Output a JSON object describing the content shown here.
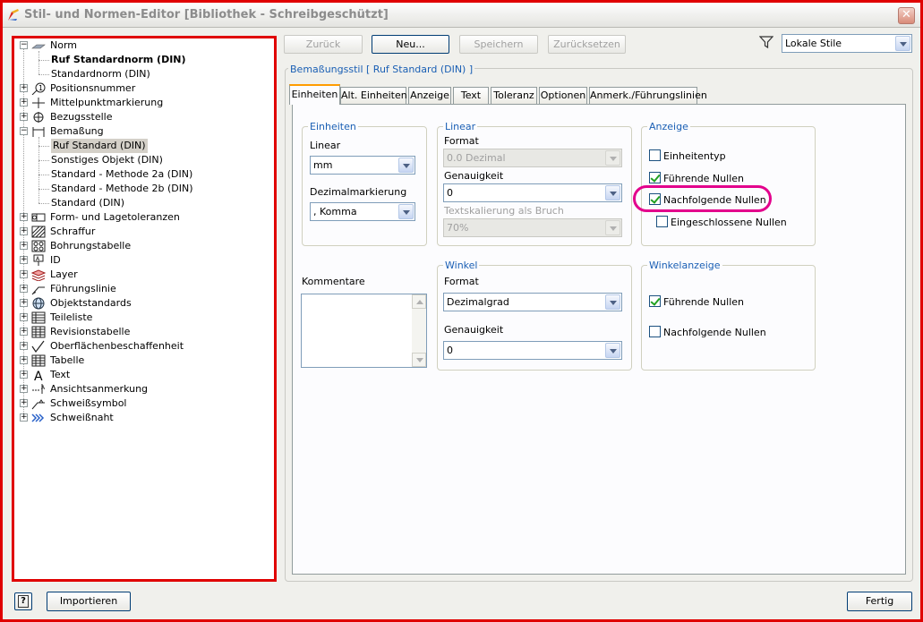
{
  "window": {
    "title": "Stil- und Normen-Editor [Bibliothek - Schreibgeschützt]",
    "close_glyph": "✕"
  },
  "toolbar": {
    "back": "Zurück",
    "new": "Neu...",
    "save": "Speichern",
    "reset": "Zurücksetzen",
    "filter_value": "Lokale Stile"
  },
  "tree": {
    "items": [
      {
        "label": "Norm",
        "icon": "norm-icon",
        "expander": "−"
      },
      {
        "label": "Ruf Standardnorm (DIN)",
        "bold": true
      },
      {
        "label": "Standardnorm (DIN)"
      },
      {
        "label": "Positionsnummer",
        "icon": "balloon-icon",
        "expander": "+"
      },
      {
        "label": "Mittelpunktmarkierung",
        "icon": "center-mark-icon",
        "expander": "+"
      },
      {
        "label": "Bezugsstelle",
        "icon": "datum-icon",
        "expander": "+"
      },
      {
        "label": "Bemaßung",
        "icon": "dimension-icon",
        "expander": "−"
      },
      {
        "label": "Ruf Standard (DIN)",
        "selected": true
      },
      {
        "label": "Sonstiges Objekt (DIN)"
      },
      {
        "label": "Standard - Methode 2a (DIN)"
      },
      {
        "label": "Standard - Methode 2b (DIN)"
      },
      {
        "label": "Standard (DIN)"
      },
      {
        "label": "Form- und Lagetoleranzen",
        "icon": "gdt-icon",
        "expander": "+"
      },
      {
        "label": "Schraffur",
        "icon": "hatch-icon",
        "expander": "+"
      },
      {
        "label": "Bohrungstabelle",
        "icon": "hole-table-icon",
        "expander": "+"
      },
      {
        "label": "ID",
        "icon": "id-icon",
        "expander": "+"
      },
      {
        "label": "Layer",
        "icon": "layer-icon",
        "expander": "+"
      },
      {
        "label": "Führungslinie",
        "icon": "leader-icon",
        "expander": "+"
      },
      {
        "label": "Objektstandards",
        "icon": "globe-icon",
        "expander": "+"
      },
      {
        "label": "Teileliste",
        "icon": "parts-list-icon",
        "expander": "+"
      },
      {
        "label": "Revisionstabelle",
        "icon": "revision-table-icon",
        "expander": "+"
      },
      {
        "label": "Oberflächenbeschaffenheit",
        "icon": "surface-icon",
        "expander": "+"
      },
      {
        "label": "Tabelle",
        "icon": "table-icon",
        "expander": "+"
      },
      {
        "label": "Text",
        "icon": "text-icon",
        "expander": "+"
      },
      {
        "label": "Ansichtsanmerkung",
        "icon": "view-annotation-icon",
        "expander": "+"
      },
      {
        "label": "Schweißsymbol",
        "icon": "weld-symbol-icon",
        "expander": "+"
      },
      {
        "label": "Schweißnaht",
        "icon": "weld-bead-icon",
        "expander": "+"
      }
    ]
  },
  "style_header": "Bemaßungsstil [ Ruf Standard (DIN) ]",
  "tabs": [
    "Einheiten",
    "Alt. Einheiten",
    "Anzeige",
    "Text",
    "Toleranz",
    "Optionen",
    "Anmerk./Führungslinien"
  ],
  "units": {
    "caption": "Einheiten",
    "linear_label": "Linear",
    "linear_value": "mm",
    "decimal_label": "Dezimalmarkierung",
    "decimal_value": ", Komma"
  },
  "linear": {
    "caption": "Linear",
    "format_label": "Format",
    "format_value": "0.0 Dezimal",
    "precision_label": "Genauigkeit",
    "precision_value": "0",
    "scale_label": "Textskalierung als Bruch",
    "scale_value": "70%"
  },
  "display": {
    "caption": "Anzeige",
    "unit_type": "Einheitentyp",
    "leading_zeros": "Führende Nullen",
    "trailing_zeros": "Nachfolgende Nullen",
    "enclosed_zeros": "Eingeschlossene Nullen"
  },
  "comments_label": "Kommentare",
  "angle": {
    "caption": "Winkel",
    "format_label": "Format",
    "format_value": "Dezimalgrad",
    "precision_label": "Genauigkeit",
    "precision_value": "0"
  },
  "angle_display": {
    "caption": "Winkelanzeige",
    "leading_zeros": "Führende Nullen",
    "trailing_zeros": "Nachfolgende Nullen"
  },
  "footer": {
    "help": "?",
    "import": "Importieren",
    "done": "Fertig"
  },
  "colors": {
    "highlight_frame": "#e00000",
    "highlight_ring": "#e3008c",
    "caption_blue": "#1a5fb4"
  }
}
